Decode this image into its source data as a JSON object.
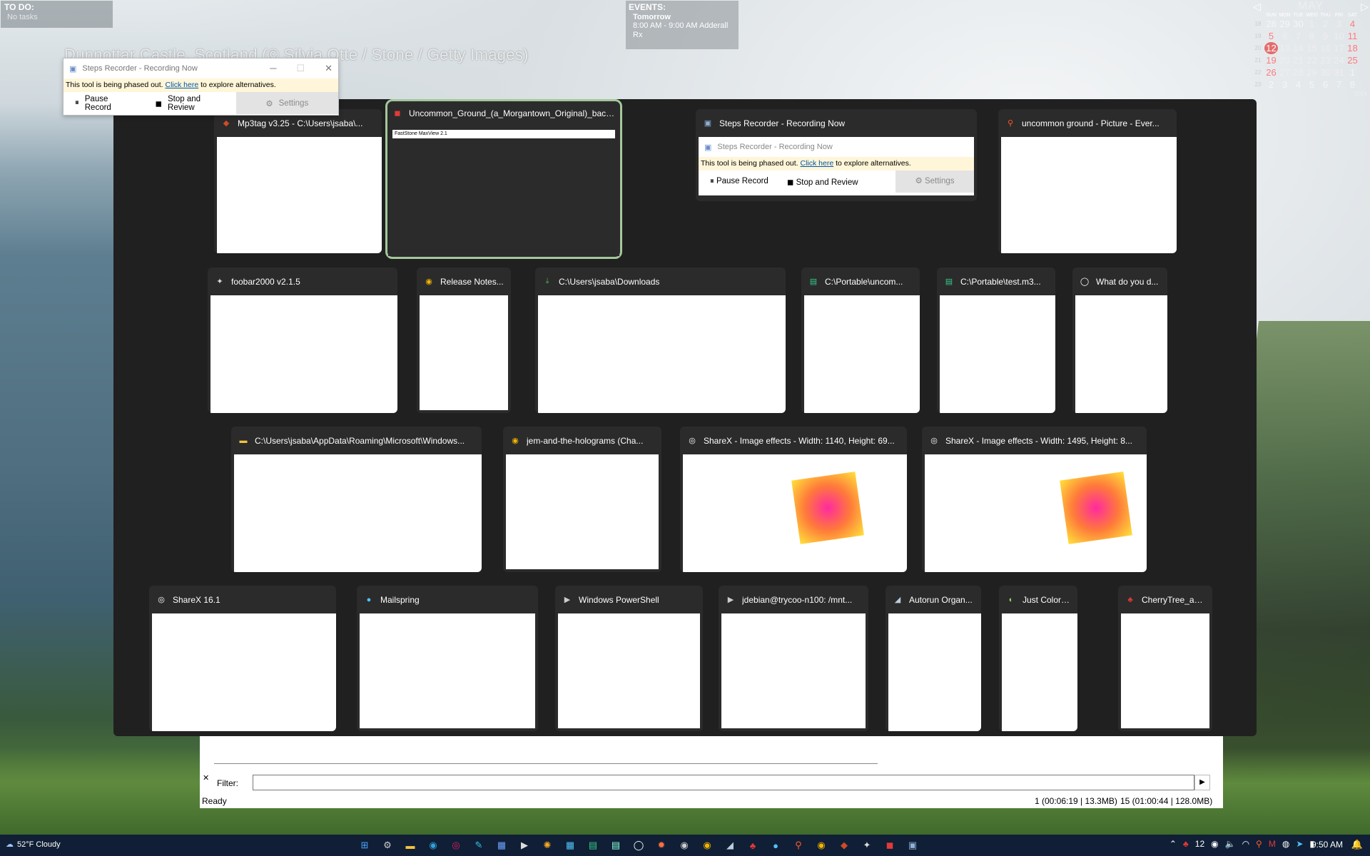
{
  "desktop": {
    "todo_title": "TO DO:",
    "todo_body": "No tasks",
    "events_title": "EVENTS:",
    "events_day": "Tomorrow",
    "events_line1": "8:00 AM - 9:00 AM Adderall",
    "events_line2": "Rx",
    "caption": "Dunnottar Castle, Scotland (© Silvia Otte / Stone / Getty Images)"
  },
  "calendar": {
    "month": "MAY",
    "year": "2024",
    "day_headers": [
      "SUN",
      "MON",
      "TUE",
      "WED",
      "THU",
      "FRI",
      "SAT"
    ],
    "weeks": [
      {
        "wk": "18",
        "days": [
          "28",
          "29",
          "30",
          "1",
          "2",
          "3",
          "4"
        ]
      },
      {
        "wk": "19",
        "days": [
          "5",
          "6",
          "7",
          "8",
          "9",
          "10",
          "11"
        ]
      },
      {
        "wk": "20",
        "days": [
          "12",
          "13",
          "14",
          "15",
          "16",
          "17",
          "18"
        ]
      },
      {
        "wk": "21",
        "days": [
          "19",
          "20",
          "21",
          "22",
          "23",
          "24",
          "25"
        ]
      },
      {
        "wk": "22",
        "days": [
          "26",
          "27",
          "28",
          "29",
          "30",
          "31",
          "1"
        ]
      },
      {
        "wk": "23",
        "days": [
          "2",
          "3",
          "4",
          "5",
          "6",
          "7",
          "8"
        ]
      }
    ],
    "today": "12"
  },
  "steps_recorder": {
    "title": "Steps Recorder - Recording Now",
    "warning_prefix": "This tool is being phased out.",
    "warning_link": "Click here",
    "warning_suffix": "to explore alternatives.",
    "pause": "Pause Record",
    "stop": "Stop and Review",
    "settings": "Settings"
  },
  "switcher": {
    "tiles": [
      {
        "title": "Mp3tag v3.25  -  C:\\Users\\jsaba\\...",
        "icon": "mp3tag-icon",
        "glyph": "◆",
        "color": "#d04a2a"
      },
      {
        "title": "Uncommon_Ground_(a_Morgantown_Original)_back.jpg - Ma...",
        "icon": "faststone-icon",
        "glyph": "◼",
        "color": "#e23a3a",
        "sub": "FastStone MaxView 2.1"
      },
      {
        "title": "Steps Recorder - Recording Now",
        "icon": "steps-recorder-icon",
        "glyph": "▣",
        "color": "#8fb1d9"
      },
      {
        "title": "uncommon ground - Picture - Ever...",
        "icon": "everything-search-icon",
        "glyph": "⚲",
        "color": "#ff5a2a"
      },
      {
        "title": "foobar2000 v2.1.5",
        "icon": "foobar-icon",
        "glyph": "✦",
        "color": "#ddd"
      },
      {
        "title": "Release Notes...",
        "icon": "chrome-icon",
        "glyph": "◉",
        "color": "#f3b400"
      },
      {
        "title": "C:\\Users\\jsaba\\Downloads",
        "icon": "download-folder-icon",
        "glyph": "⤓",
        "color": "#4caf50"
      },
      {
        "title": "C:\\Portable\\uncom...",
        "icon": "notepad-icon",
        "glyph": "▤",
        "color": "#37c98a"
      },
      {
        "title": "C:\\Portable\\test.m3...",
        "icon": "notepad-icon",
        "glyph": "▤",
        "color": "#37c98a"
      },
      {
        "title": "What do you d...",
        "icon": "browser-icon",
        "glyph": "◯",
        "color": "#fff"
      },
      {
        "title": "C:\\Users\\jsaba\\AppData\\Roaming\\Microsoft\\Windows...",
        "icon": "folder-icon",
        "glyph": "▬",
        "color": "#f3c242"
      },
      {
        "title": "jem-and-the-holograms (Cha...",
        "icon": "chrome-icon",
        "glyph": "◉",
        "color": "#f3b400"
      },
      {
        "title": "ShareX - Image effects - Width: 1140, Height: 69...",
        "icon": "sharex-icon",
        "glyph": "◎",
        "color": "#fff"
      },
      {
        "title": "ShareX - Image effects - Width: 1495, Height: 8...",
        "icon": "sharex-icon",
        "glyph": "◎",
        "color": "#fff"
      },
      {
        "title": "ShareX 16.1",
        "icon": "sharex-icon",
        "glyph": "◎",
        "color": "#fff"
      },
      {
        "title": "Mailspring",
        "icon": "mailspring-icon",
        "glyph": "●",
        "color": "#4fc3f7"
      },
      {
        "title": "Windows PowerShell",
        "icon": "powershell-icon",
        "glyph": "▶",
        "color": "#ccc"
      },
      {
        "title": "jdebian@trycoo-n100: /mnt...",
        "icon": "terminal-icon",
        "glyph": "▶",
        "color": "#ccc"
      },
      {
        "title": "Autorun Organ...",
        "icon": "autorun-organizer-icon",
        "glyph": "◢",
        "color": "#bcd"
      },
      {
        "title": "Just Color Picker",
        "icon": "color-picker-icon",
        "glyph": "◐",
        "color": "#9ccc65"
      },
      {
        "title": "CherryTree_as_...",
        "icon": "cherrytree-icon",
        "glyph": "♣",
        "color": "#e53935"
      }
    ]
  },
  "back_app": {
    "filter_label": "Filter:",
    "status": "Ready",
    "status_mid": "1 (00:06:19 | 13.3MB)",
    "status_right": "15 (01:00:44 | 128.0MB)"
  },
  "taskbar": {
    "weather": "52°F Cloudy",
    "clock": "9:50 AM",
    "tray_number": "12",
    "pinned": [
      {
        "icon": "start-icon",
        "glyph": "⊞",
        "color": "#4aa3ff"
      },
      {
        "icon": "settings-icon",
        "glyph": "⚙",
        "color": "#ccc"
      },
      {
        "icon": "file-explorer-icon",
        "glyph": "▬",
        "color": "#f3c242"
      },
      {
        "icon": "edge-icon",
        "glyph": "◉",
        "color": "#2fa3de"
      },
      {
        "icon": "app-icon",
        "glyph": "◎",
        "color": "#e91e63"
      },
      {
        "icon": "app-icon",
        "glyph": "✎",
        "color": "#30c0e0"
      },
      {
        "icon": "calendar-icon",
        "glyph": "▦",
        "color": "#6aa0ff"
      },
      {
        "icon": "terminal-icon",
        "glyph": "▶",
        "color": "#ddd"
      },
      {
        "icon": "app-icon",
        "glyph": "✺",
        "color": "#f9a825"
      },
      {
        "icon": "app-icon",
        "glyph": "▦",
        "color": "#4fc3f7"
      },
      {
        "icon": "notepad-icon",
        "glyph": "▤",
        "color": "#37c98a"
      },
      {
        "icon": "notepad-icon",
        "glyph": "▤",
        "color": "#8fd"
      },
      {
        "icon": "browser-icon",
        "glyph": "◯",
        "color": "#fff"
      },
      {
        "icon": "app-icon",
        "glyph": "✹",
        "color": "#ff7043"
      },
      {
        "icon": "app-icon",
        "glyph": "◉",
        "color": "#ccc"
      },
      {
        "icon": "chrome-icon",
        "glyph": "◉",
        "color": "#f3b400"
      },
      {
        "icon": "app-icon",
        "glyph": "◢",
        "color": "#bcd"
      },
      {
        "icon": "cherrytree-icon",
        "glyph": "♣",
        "color": "#e53935"
      },
      {
        "icon": "mailspring-icon",
        "glyph": "●",
        "color": "#4fc3f7"
      },
      {
        "icon": "search-icon",
        "glyph": "⚲",
        "color": "#ff5a2a"
      },
      {
        "icon": "chrome-icon",
        "glyph": "◉",
        "color": "#f3b400"
      },
      {
        "icon": "mp3tag-icon",
        "glyph": "◆",
        "color": "#d04a2a"
      },
      {
        "icon": "foobar-icon",
        "glyph": "✦",
        "color": "#ddd"
      },
      {
        "icon": "faststone-icon",
        "glyph": "◼",
        "color": "#e23a3a"
      },
      {
        "icon": "steps-recorder-icon",
        "glyph": "▣",
        "color": "#8fb1d9"
      }
    ]
  }
}
